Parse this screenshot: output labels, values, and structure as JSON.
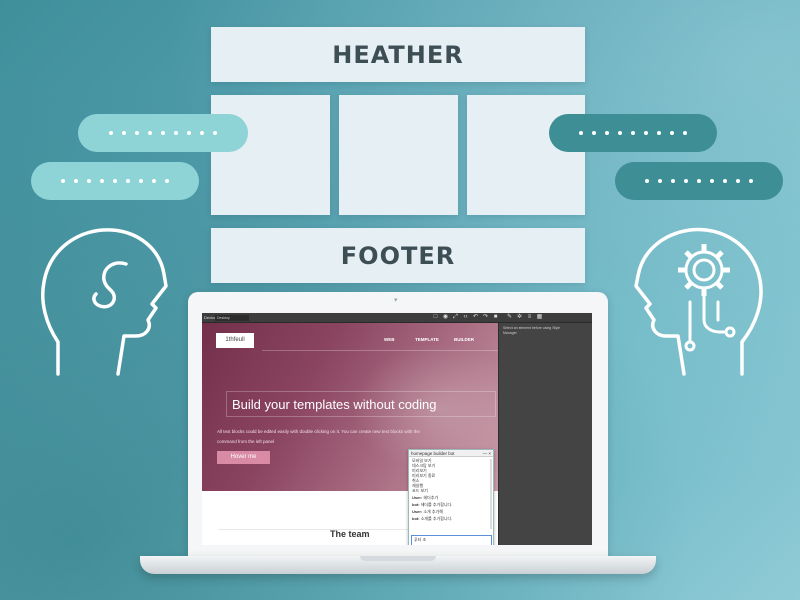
{
  "wireframe": {
    "header_label": "HEATHER",
    "footer_label": "FOOTER"
  },
  "colors": {
    "pill_light": "#8ed3d5",
    "pill_dark": "#3e8e96",
    "hero_accent": "#74304a",
    "button_pink": "#d98aa5"
  },
  "icons": {
    "left_head": "human-head-outline-icon",
    "right_head": "ai-head-gear-icon"
  },
  "app": {
    "device_label": "Device",
    "device_value": "Desktop",
    "toolbar_icons": [
      "square-outline-icon",
      "eye-icon",
      "fullscreen-icon",
      "code-icon",
      "undo-icon",
      "redo-icon",
      "trash-icon"
    ],
    "panel_icons": [
      "brush-icon",
      "gear-icon",
      "menu-icon",
      "grid-icon"
    ],
    "panel_hint": "Select an element before using Style Manager",
    "site": {
      "logo": "1thfeull",
      "nav": [
        "WEB",
        "TEMPLATE",
        "BUILDER"
      ],
      "hero_title": "Build your templates without coding",
      "hero_desc": "All text blocks could be edited easily with double clicking on it. You can create new text blocks with the command from the left panel",
      "hover_button": "Hover me",
      "team_title": "The team"
    },
    "chat": {
      "title": "homepage builder bot",
      "controls": "— ×",
      "menu_items": [
        "모바일 보기",
        "데스크탑 보기",
        "미리보기",
        "미리보기 종료",
        "취소",
        "재실행",
        "코드 보기"
      ],
      "messages": [
        {
          "speaker": "User:",
          "text": "헤더추가"
        },
        {
          "speaker": "bot:",
          "text": "헤더를 추가합니다."
        },
        {
          "speaker": "User:",
          "text": "소개 추가해"
        },
        {
          "speaker": "bot:",
          "text": "소개를 추가합니다."
        }
      ],
      "input_value": "푸터 조"
    }
  }
}
